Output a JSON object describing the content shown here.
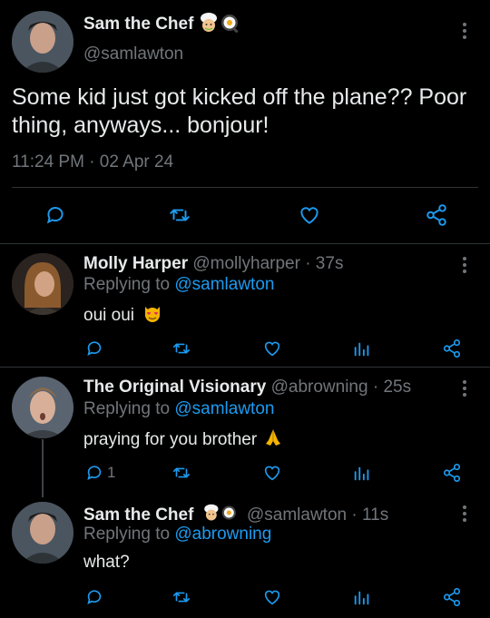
{
  "main_tweet": {
    "display_name": "Sam the Chef",
    "badges": [
      "chef-emoji",
      "egg-emoji"
    ],
    "handle": "@samlawton",
    "text": "Some kid just got kicked off the plane?? Poor thing, anyways... bonjour!",
    "timestamp": "11:24 PM · 02 Apr 24"
  },
  "replies": [
    {
      "display_name": "Molly Harper",
      "handle_time": "@mollyharper · 37s",
      "replying_prefix": "Replying to ",
      "replying_to": "@samlawton",
      "text": "oui oui",
      "emoji": "heart-eyes-cat-emoji",
      "reply_count": ""
    },
    {
      "display_name": "The Original Visionary",
      "handle_time": "@abrowning · 25s",
      "replying_prefix": "Replying to ",
      "replying_to": "@samlawton",
      "text": "praying for you brother",
      "emoji": "folded-hands-emoji",
      "reply_count": "1"
    },
    {
      "display_name": "Sam the Chef",
      "handle_time": "@samlawton · 11s",
      "replying_prefix": "Replying to ",
      "replying_to": "@abrowning",
      "text": "what?",
      "emoji": "",
      "reply_count": ""
    }
  ],
  "colors": {
    "background": "#000000",
    "text": "#e7e9ea",
    "muted": "#71767b",
    "link": "#1d9bf0",
    "divider": "#2f3336"
  }
}
